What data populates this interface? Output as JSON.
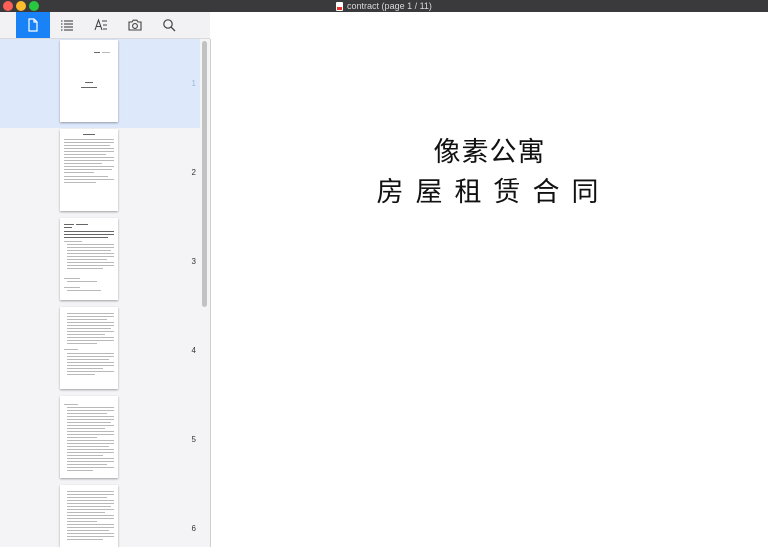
{
  "window": {
    "title": "contract (page 1 / 11)"
  },
  "toolbar": {
    "buttons": [
      {
        "icon": "page-thumbnails-icon",
        "active": true
      },
      {
        "icon": "outline-list-icon",
        "active": false
      },
      {
        "icon": "annotations-icon",
        "active": false
      },
      {
        "icon": "camera-icon",
        "active": false
      },
      {
        "icon": "search-icon",
        "active": false
      }
    ]
  },
  "sidebar": {
    "pages": [
      {
        "number": "1",
        "selected": true
      },
      {
        "number": "2",
        "selected": false
      },
      {
        "number": "3",
        "selected": false
      },
      {
        "number": "4",
        "selected": false
      },
      {
        "number": "5",
        "selected": false
      },
      {
        "number": "6",
        "selected": false
      }
    ]
  },
  "document": {
    "line1": "像素公寓",
    "line2": "房屋租赁合同"
  },
  "colors": {
    "accent": "#1a82f7",
    "selection": "#dde9fb",
    "titlebar": "#3a3a3c"
  }
}
